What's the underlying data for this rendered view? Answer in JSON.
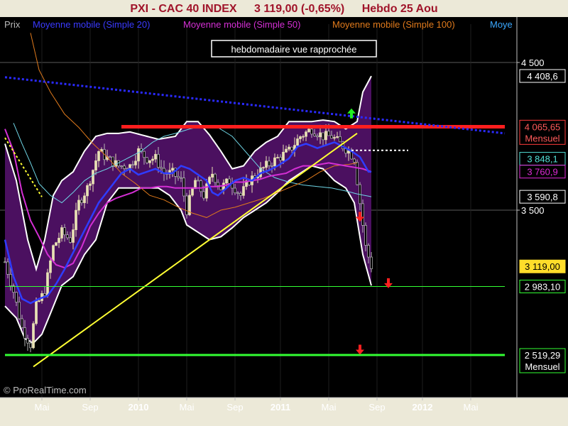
{
  "header": {
    "name": "PXI - CAC 40 INDEX",
    "last": "3 119,00 (-0,65%)",
    "period": "Hebdo  25 Aou"
  },
  "legend": [
    {
      "label": "Prix",
      "color": "#b9b9b9"
    },
    {
      "label": "Moyenne mobile (Simple 20)",
      "color": "#3a3aff"
    },
    {
      "label": "Moyenne mobile (Simple 50)",
      "color": "#d42fd4"
    },
    {
      "label": "Moyenne mobile (Simple 100)",
      "color": "#e07a1c"
    },
    {
      "label": "Moye",
      "color": "#3aa8ff"
    }
  ],
  "annotation": "hebdomadaire vue rapprochée",
  "copyright": "© ProRealTime.com",
  "chart_data": {
    "type": "line",
    "subtype": "candlestick-weekly-with-moving-averages-and-bollinger",
    "ylim": [
      2350,
      4700
    ],
    "y_ticks": [
      {
        "label": "4 500",
        "value": 4500
      },
      {
        "label": "3 500",
        "value": 3500
      }
    ],
    "x_ticks": [
      {
        "label": "Mai",
        "t": 13
      },
      {
        "label": "Sep",
        "t": 30
      },
      {
        "label": "2010",
        "t": 47,
        "bold": true
      },
      {
        "label": "Mai",
        "t": 64
      },
      {
        "label": "Sep",
        "t": 81
      },
      {
        "label": "2011",
        "t": 97,
        "bold": true
      },
      {
        "label": "Mai",
        "t": 114
      },
      {
        "label": "Sep",
        "t": 131
      },
      {
        "label": "2012",
        "t": 147,
        "bold": true
      },
      {
        "label": "Mai",
        "t": 164
      }
    ],
    "price_key": [
      [
        0,
        3150
      ],
      [
        3,
        2950
      ],
      [
        6,
        2700
      ],
      [
        9,
        2590
      ],
      [
        11,
        2850
      ],
      [
        14,
        2950
      ],
      [
        17,
        3250
      ],
      [
        20,
        3350
      ],
      [
        23,
        3300
      ],
      [
        26,
        3550
      ],
      [
        29,
        3650
      ],
      [
        33,
        3900
      ],
      [
        36,
        3850
      ],
      [
        40,
        3800
      ],
      [
        44,
        3800
      ],
      [
        47,
        3900
      ],
      [
        50,
        3850
      ],
      [
        53,
        3850
      ],
      [
        56,
        3750
      ],
      [
        59,
        3750
      ],
      [
        62,
        3700
      ],
      [
        64,
        3500
      ],
      [
        67,
        3700
      ],
      [
        70,
        3600
      ],
      [
        73,
        3750
      ],
      [
        76,
        3650
      ],
      [
        79,
        3700
      ],
      [
        83,
        3600
      ],
      [
        86,
        3700
      ],
      [
        89,
        3750
      ],
      [
        92,
        3800
      ],
      [
        96,
        3850
      ],
      [
        100,
        3900
      ],
      [
        104,
        4000
      ],
      [
        108,
        4050
      ],
      [
        112,
        4000
      ],
      [
        115,
        4000
      ],
      [
        118,
        3950
      ],
      [
        121,
        3900
      ],
      [
        123,
        3850
      ],
      [
        125,
        3550
      ],
      [
        127,
        3250
      ],
      [
        129,
        3120
      ]
    ],
    "bollinger_upper_key": [
      [
        0,
        3950
      ],
      [
        4,
        3700
      ],
      [
        8,
        3300
      ],
      [
        11,
        3100
      ],
      [
        14,
        3300
      ],
      [
        17,
        3600
      ],
      [
        20,
        3700
      ],
      [
        24,
        3760
      ],
      [
        28,
        3900
      ],
      [
        32,
        4000
      ],
      [
        36,
        4020
      ],
      [
        40,
        4020
      ],
      [
        44,
        4030
      ],
      [
        50,
        4000
      ],
      [
        54,
        3980
      ],
      [
        60,
        4000
      ],
      [
        64,
        4100
      ],
      [
        68,
        4100
      ],
      [
        72,
        4010
      ],
      [
        76,
        3900
      ],
      [
        80,
        3780
      ],
      [
        84,
        3800
      ],
      [
        88,
        3900
      ],
      [
        92,
        3960
      ],
      [
        96,
        4000
      ],
      [
        100,
        4100
      ],
      [
        104,
        4100
      ],
      [
        108,
        4100
      ],
      [
        112,
        4110
      ],
      [
        116,
        4100
      ],
      [
        120,
        4050
      ],
      [
        124,
        4100
      ],
      [
        126,
        4300
      ],
      [
        129,
        4408
      ]
    ],
    "bollinger_lower_key": [
      [
        0,
        2850
      ],
      [
        4,
        2770
      ],
      [
        7,
        2630
      ],
      [
        10,
        2600
      ],
      [
        13,
        2660
      ],
      [
        16,
        2800
      ],
      [
        20,
        2990
      ],
      [
        24,
        3050
      ],
      [
        28,
        3200
      ],
      [
        32,
        3300
      ],
      [
        36,
        3550
      ],
      [
        40,
        3650
      ],
      [
        44,
        3650
      ],
      [
        50,
        3650
      ],
      [
        54,
        3650
      ],
      [
        58,
        3600
      ],
      [
        62,
        3500
      ],
      [
        64,
        3400
      ],
      [
        68,
        3350
      ],
      [
        72,
        3300
      ],
      [
        76,
        3320
      ],
      [
        80,
        3380
      ],
      [
        84,
        3450
      ],
      [
        88,
        3500
      ],
      [
        92,
        3550
      ],
      [
        96,
        3620
      ],
      [
        100,
        3700
      ],
      [
        104,
        3750
      ],
      [
        108,
        3800
      ],
      [
        112,
        3780
      ],
      [
        116,
        3700
      ],
      [
        120,
        3650
      ],
      [
        123,
        3550
      ],
      [
        126,
        3200
      ],
      [
        129,
        2990
      ]
    ],
    "ma20_key": [
      [
        0,
        3300
      ],
      [
        3,
        3050
      ],
      [
        6,
        2900
      ],
      [
        9,
        2870
      ],
      [
        12,
        2900
      ],
      [
        15,
        2920
      ],
      [
        18,
        3000
      ],
      [
        21,
        3100
      ],
      [
        25,
        3250
      ],
      [
        29,
        3400
      ],
      [
        33,
        3550
      ],
      [
        37,
        3650
      ],
      [
        41,
        3750
      ],
      [
        44,
        3780
      ],
      [
        47,
        3740
      ],
      [
        50,
        3760
      ],
      [
        53,
        3780
      ],
      [
        56,
        3750
      ],
      [
        59,
        3750
      ],
      [
        62,
        3800
      ],
      [
        65,
        3780
      ],
      [
        68,
        3740
      ],
      [
        71,
        3700
      ],
      [
        73,
        3620
      ],
      [
        75,
        3600
      ],
      [
        78,
        3650
      ],
      [
        81,
        3700
      ],
      [
        84,
        3720
      ],
      [
        87,
        3700
      ],
      [
        90,
        3750
      ],
      [
        93,
        3770
      ],
      [
        96,
        3800
      ],
      [
        100,
        3850
      ],
      [
        103,
        3930
      ],
      [
        106,
        3950
      ],
      [
        110,
        3920
      ],
      [
        113,
        3940
      ],
      [
        116,
        3960
      ],
      [
        119,
        3930
      ],
      [
        122,
        3900
      ],
      [
        125,
        3860
      ],
      [
        128,
        3760
      ],
      [
        129,
        3760
      ]
    ],
    "ma50_key": [
      [
        0,
        4050
      ],
      [
        3,
        3900
      ],
      [
        6,
        3620
      ],
      [
        9,
        3430
      ],
      [
        12,
        3320
      ],
      [
        15,
        3200
      ],
      [
        18,
        3130
      ],
      [
        21,
        3110
      ],
      [
        24,
        3140
      ],
      [
        27,
        3250
      ],
      [
        30,
        3390
      ],
      [
        33,
        3480
      ],
      [
        36,
        3550
      ],
      [
        39,
        3580
      ],
      [
        42,
        3600
      ],
      [
        45,
        3620
      ],
      [
        48,
        3650
      ],
      [
        51,
        3650
      ],
      [
        54,
        3660
      ],
      [
        57,
        3660
      ],
      [
        60,
        3650
      ],
      [
        63,
        3650
      ],
      [
        66,
        3650
      ],
      [
        69,
        3650
      ],
      [
        72,
        3660
      ],
      [
        75,
        3660
      ],
      [
        78,
        3670
      ],
      [
        81,
        3690
      ],
      [
        84,
        3690
      ],
      [
        87,
        3700
      ],
      [
        90,
        3710
      ],
      [
        93,
        3730
      ],
      [
        96,
        3740
      ],
      [
        99,
        3750
      ],
      [
        102,
        3780
      ],
      [
        105,
        3800
      ],
      [
        108,
        3800
      ],
      [
        111,
        3810
      ],
      [
        114,
        3820
      ],
      [
        117,
        3810
      ],
      [
        120,
        3800
      ],
      [
        123,
        3790
      ],
      [
        126,
        3780
      ],
      [
        129,
        3760
      ]
    ],
    "ma100_key": [
      [
        9,
        4700
      ],
      [
        12,
        4450
      ],
      [
        16,
        4300
      ],
      [
        21,
        4150
      ],
      [
        26,
        4060
      ],
      [
        31,
        3950
      ],
      [
        36,
        3860
      ],
      [
        41,
        3750
      ],
      [
        46,
        3680
      ],
      [
        51,
        3600
      ],
      [
        56,
        3570
      ],
      [
        61,
        3520
      ],
      [
        66,
        3480
      ],
      [
        71,
        3450
      ],
      [
        76,
        3500
      ],
      [
        81,
        3520
      ],
      [
        86,
        3550
      ],
      [
        91,
        3580
      ],
      [
        96,
        3620
      ],
      [
        101,
        3660
      ],
      [
        106,
        3700
      ],
      [
        111,
        3760
      ],
      [
        116,
        3800
      ],
      [
        121,
        3810
      ],
      [
        124,
        3820
      ]
    ],
    "ma_cyan_key": [
      [
        3,
        4090
      ],
      [
        6,
        3950
      ],
      [
        9,
        3820
      ],
      [
        12,
        3680
      ],
      [
        16,
        3600
      ],
      [
        20,
        3550
      ],
      [
        24,
        3620
      ],
      [
        28,
        3700
      ],
      [
        32,
        3750
      ],
      [
        36,
        3780
      ],
      [
        40,
        3820
      ],
      [
        44,
        3860
      ],
      [
        48,
        3900
      ],
      [
        52,
        3960
      ],
      [
        56,
        4000
      ],
      [
        60,
        4020
      ],
      [
        65,
        4050
      ],
      [
        70,
        4070
      ],
      [
        75,
        4060
      ],
      [
        80,
        4000
      ],
      [
        85,
        3890
      ],
      [
        90,
        3780
      ],
      [
        95,
        3720
      ],
      [
        100,
        3690
      ],
      [
        105,
        3670
      ],
      [
        110,
        3660
      ],
      [
        115,
        3650
      ],
      [
        120,
        3630
      ],
      [
        124,
        3610
      ],
      [
        129,
        3591
      ]
    ],
    "lines": [
      {
        "name": "red-resistance",
        "from": [
          41,
          4065
        ],
        "to": [
          176,
          4065
        ],
        "color": "#ff1e1e",
        "width": 5
      },
      {
        "name": "yellow-trendline",
        "from": [
          10,
          2440
        ],
        "to": [
          124,
          4020
        ],
        "color": "#ffff33",
        "width": 2
      },
      {
        "name": "blue-dotted-downtrend",
        "from": [
          0,
          4400
        ],
        "to": [
          176,
          4020
        ],
        "color": "#2a2aff",
        "width": 3,
        "dash": "3 3"
      },
      {
        "name": "green-support-upper",
        "from": [
          0,
          2983
        ],
        "to": [
          176,
          2983
        ],
        "color": "#33ff33",
        "width": 1
      },
      {
        "name": "green-support-lower",
        "from": [
          0,
          2519
        ],
        "to": [
          176,
          2519
        ],
        "color": "#33ff33",
        "width": 3
      },
      {
        "name": "white-dotted-level",
        "from": [
          122,
          3905
        ],
        "to": [
          142,
          3905
        ],
        "color": "#ffffff",
        "width": 2,
        "dash": "3 3"
      },
      {
        "name": "yellow-dotted-short",
        "from": [
          0,
          3990
        ],
        "to": [
          13,
          3590
        ],
        "color": "#ffff33",
        "width": 2,
        "dash": "3 3"
      }
    ],
    "right_labels": [
      {
        "text": "4 408,6",
        "value": 4408.6,
        "bg": "#000000",
        "fg": "#ffffff",
        "border": "#ffffff"
      },
      {
        "text": "4 065,65",
        "value": 4065.65,
        "bg": "#000000",
        "fg": "#ff5a5a",
        "border": "#ff3c3c",
        "sub": "Mensuel"
      },
      {
        "text": "3 848,1",
        "value": 3848.1,
        "bg": "#000000",
        "fg": "#52e0d6",
        "border": "#52e0d6"
      },
      {
        "text": "3 760,9",
        "value": 3760.9,
        "bg": "#000000",
        "fg": "#e02ad8",
        "border": "#e02ad8"
      },
      {
        "text": "3 590,8",
        "value": 3590.8,
        "bg": "#000000",
        "fg": "#ffffff",
        "border": "#ffffff"
      },
      {
        "text": "3 119,00",
        "value": 3119.0,
        "bg": "#ffdd2a",
        "fg": "#000000",
        "border": "#ffdd2a"
      },
      {
        "text": "2 983,10",
        "value": 2983.1,
        "bg": "#000000",
        "fg": "#ffffff",
        "border": "#33ff33"
      },
      {
        "text": "2 519,29",
        "value": 2519.29,
        "bg": "#000000",
        "fg": "#ffffff",
        "border": "#33ff33",
        "sub": "Mensuel"
      }
    ],
    "arrows": [
      {
        "t": 122,
        "y": 4150,
        "dir": "up",
        "color": "#22ee22"
      },
      {
        "t": 125,
        "y": 3460,
        "dir": "down",
        "color": "#ff2020"
      },
      {
        "t": 135,
        "y": 3010,
        "dir": "down",
        "color": "#ff2020"
      },
      {
        "t": 125,
        "y": 2560,
        "dir": "down",
        "color": "#ff2020"
      }
    ],
    "colors": {
      "bg": "#000000",
      "band_fill": "#4b1060",
      "band_edge": "#ffffff",
      "candle_up": "#e8e1b4",
      "candle_down": "#b9b9b9",
      "ma20": "#2f3cff",
      "ma50": "#d42fd4",
      "ma100": "#e07a1c",
      "ma_cyan": "#6fd6e6",
      "grid": "#3a3a3a",
      "frame": "#c0c0c0"
    }
  }
}
